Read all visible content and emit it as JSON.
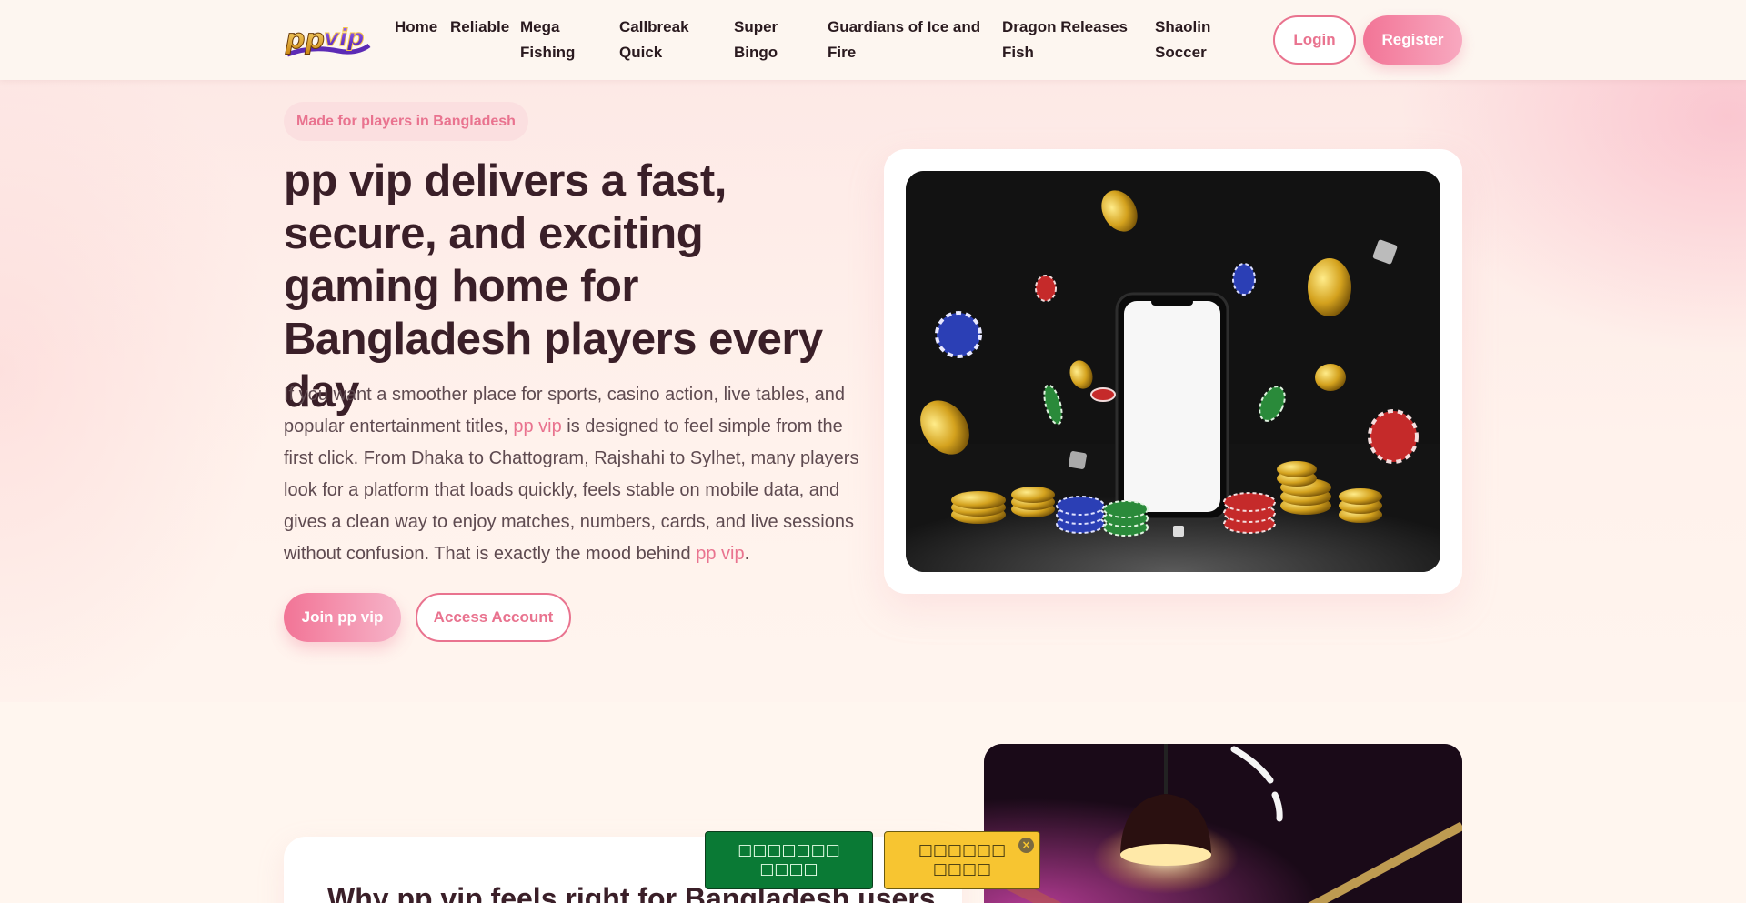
{
  "header": {
    "logo_text": "ppvip",
    "nav": [
      {
        "label": "Home"
      },
      {
        "label": "Reliable"
      },
      {
        "label": "Mega Fishing"
      },
      {
        "label": "Callbreak Quick"
      },
      {
        "label": "Super Bingo"
      },
      {
        "label": "Guardians of Ice and Fire"
      },
      {
        "label": "Dragon Releases Fish"
      },
      {
        "label": "Shaolin Soccer"
      }
    ],
    "login_label": "Login",
    "register_label": "Register"
  },
  "hero": {
    "badge": "Made for players in Bangladesh",
    "title": "pp vip delivers a fast, secure, and exciting gaming home for Bangladesh players every day",
    "text_1": "If you want a smoother place for sports, casino action, live tables, and popular entertainment titles, ",
    "link_1": "pp vip",
    "text_2": " is designed to feel simple from the first click. From Dhaka to Chattogram, Rajshahi to Sylhet, many players look for a platform that loads quickly, feels stable on mobile data, and gives a clean way to enjoy matches, numbers, cards, and live sessions without confusion. That is exactly the mood behind ",
    "link_2": "pp vip",
    "text_3": ".",
    "join_label": "Join pp vip",
    "access_label": "Access Account"
  },
  "section2": {
    "title": "Why pp vip feels right for Bangladesh users"
  },
  "floating": {
    "green_label": "□□□□□□□ □□□□",
    "yellow_label": "□□□□□□ □□□□",
    "close_glyph": "×"
  },
  "colors": {
    "accent": "#e9738f",
    "green": "#0a7a35",
    "yellow": "#f7c531"
  }
}
